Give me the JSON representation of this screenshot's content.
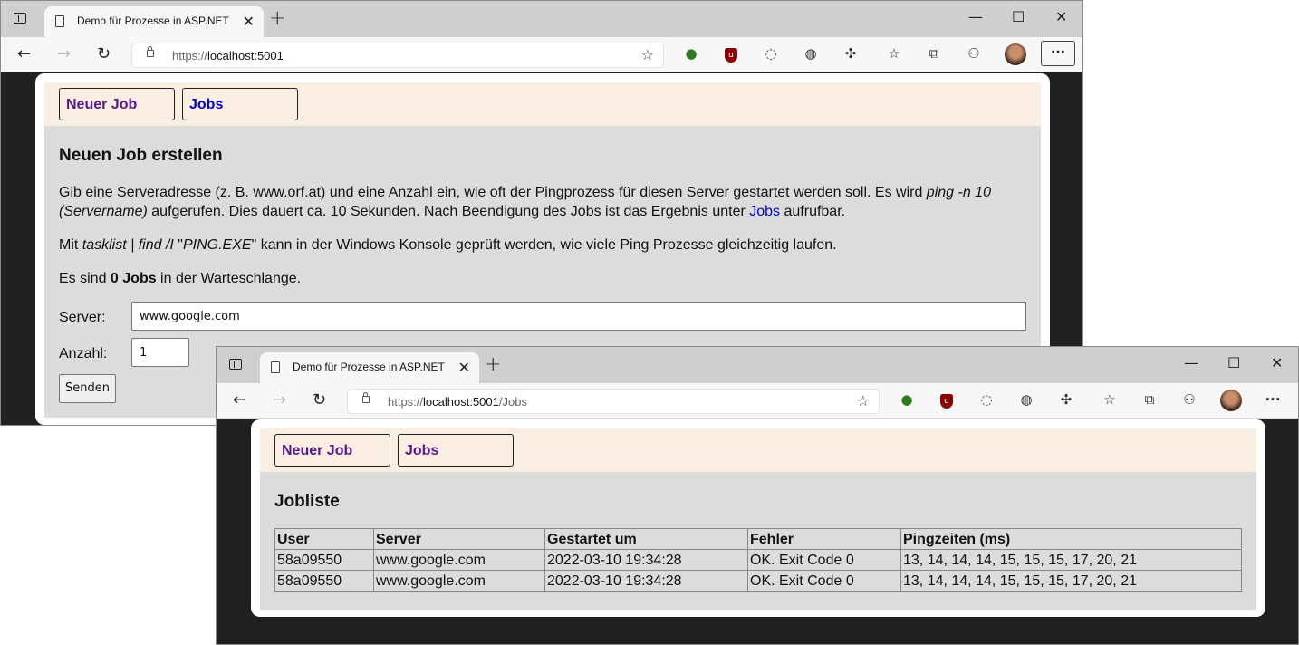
{
  "window1": {
    "tab_title": "Demo für Prozesse in ASP.NET",
    "url_proto": "https://",
    "url_host": "localhost:5001",
    "url_path": "",
    "nav": {
      "neuer_job": "Neuer Job",
      "jobs": "Jobs"
    },
    "heading": "Neuen Job erstellen",
    "p1_a": "Gib eine Serveradresse (z. B. www.orf.at) und eine Anzahl ein, wie oft der Pingprozess für diesen Server gestartet werden soll. Es wird ",
    "p1_em": "ping -n 10",
    "p1_em2": "(Servername)",
    "p1_b": " aufgerufen. Dies dauert ca. 10 Sekunden. Nach Beendigung des Jobs ist das Ergebnis unter ",
    "p1_link": "Jobs",
    "p1_c": " aufrufbar.",
    "p2_a": "Mit ",
    "p2_em": "tasklist | find /I",
    "p2_b": " \"",
    "p2_em2": "PING.EXE",
    "p2_c": "\" kann in der Windows Konsole geprüft werden, wie viele Ping Prozesse gleichzeitig laufen.",
    "p3_a": "Es sind ",
    "p3_strong": "0 Jobs",
    "p3_b": " in der Warteschlange.",
    "server_label": "Server:",
    "server_value": "www.google.com",
    "anzahl_label": "Anzahl:",
    "anzahl_value": "1",
    "submit_label": "Senden"
  },
  "window2": {
    "tab_title": "Demo für Prozesse in ASP.NET",
    "url_proto": "https://",
    "url_host": "localhost:5001",
    "url_path": "/Jobs",
    "nav": {
      "neuer_job": "Neuer Job",
      "jobs": "Jobs"
    },
    "heading": "Jobliste",
    "columns": [
      "User",
      "Server",
      "Gestartet um",
      "Fehler",
      "Pingzeiten (ms)"
    ],
    "rows": [
      [
        "58a09550",
        "www.google.com",
        "2022-03-10 19:34:28",
        "OK. Exit Code 0",
        "13, 14, 14, 14, 15, 15, 15, 17, 20, 21"
      ],
      [
        "58a09550",
        "www.google.com",
        "2022-03-10 19:34:28",
        "OK. Exit Code 0",
        "13, 14, 14, 14, 15, 15, 15, 17, 20, 21"
      ]
    ]
  },
  "browser": {
    "tab_close": "✕",
    "new_tab": "+",
    "back": "←",
    "forward": "→",
    "reload": "↻",
    "more": "···",
    "min": "—",
    "max": "☐",
    "close": "✕"
  }
}
